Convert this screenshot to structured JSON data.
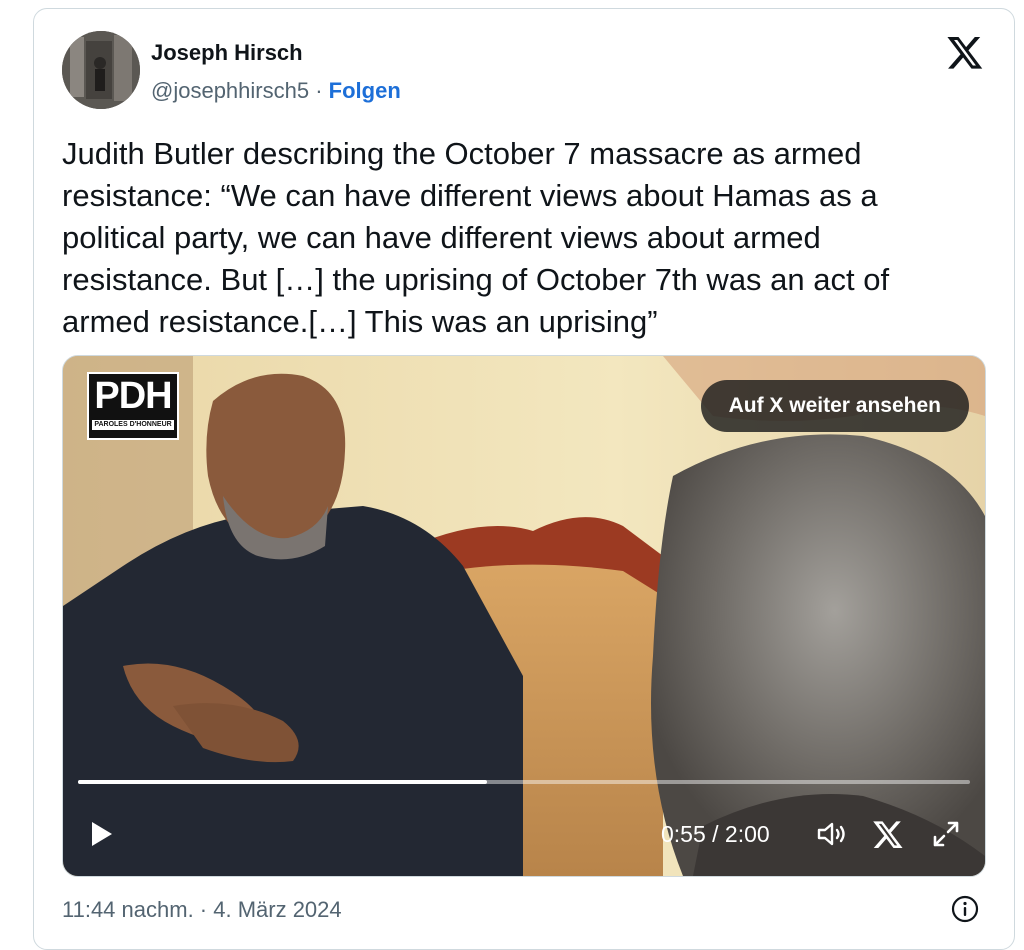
{
  "tweet": {
    "author_name": "Joseph Hirsch",
    "handle": "@josephhirsch5",
    "separator": "·",
    "follow_label": "Folgen",
    "text": "Judith Butler describing the October 7 massacre as armed\nresistance: “We can have different views about Hamas as a\npolitical party, we can have different views about armed\nresistance. But […] the uprising of October 7th was an act of\narmed resistance.[…] This was an uprising”",
    "timestamp": "11:44 nachm. · 4. März 2024"
  },
  "video": {
    "logo_text": "PDH",
    "logo_subtext": "PAROLES D'HONNEUR",
    "watch_label": "Auf X weiter ansehen",
    "time_display": "0:55 / 2:00",
    "progress_fraction": 0.458
  },
  "icons": {
    "brand": "x-logo-icon",
    "play": "play-icon",
    "volume": "volume-icon",
    "x_small": "x-logo-icon",
    "fullscreen": "fullscreen-icon",
    "info": "info-icon"
  },
  "colors": {
    "accent": "#1d6fd8",
    "text": "#0f1419",
    "secondary": "#536471",
    "border": "#cfd9de"
  }
}
